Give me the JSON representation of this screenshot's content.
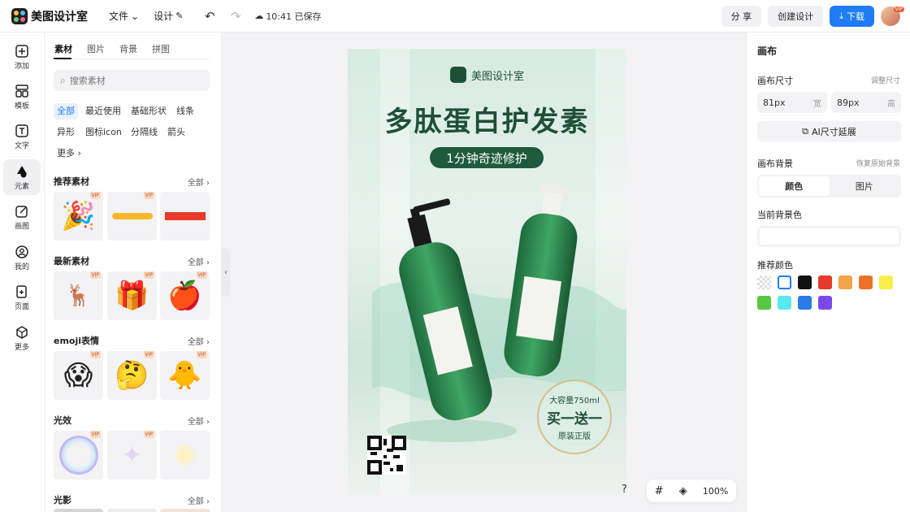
{
  "app": {
    "name": "美图设计室",
    "save_status": "10:41 已保存"
  },
  "topbar": {
    "file_menu": "文件",
    "design_menu": "设计",
    "share": "分 享",
    "create": "创建设计",
    "download": "下载",
    "avatar_badge": "VIP"
  },
  "rail": [
    {
      "label": "添加",
      "icon": "plus-square-icon"
    },
    {
      "label": "模板",
      "icon": "template-icon"
    },
    {
      "label": "文字",
      "icon": "text-icon"
    },
    {
      "label": "元素",
      "icon": "shapes-icon"
    },
    {
      "label": "画图",
      "icon": "pen-icon"
    },
    {
      "label": "我的",
      "icon": "user-icon"
    },
    {
      "label": "页面",
      "icon": "page-icon"
    },
    {
      "label": "更多",
      "icon": "cube-icon"
    }
  ],
  "panel": {
    "tabs": [
      "素材",
      "图片",
      "背景",
      "拼图"
    ],
    "search_placeholder": "搜索素材",
    "chips": [
      "全部",
      "最近使用",
      "基础形状",
      "线条",
      "异形",
      "图标icon",
      "分隔线",
      "箭头",
      "更多"
    ],
    "sections": [
      {
        "title": "推荐素材",
        "all": "全部"
      },
      {
        "title": "最新素材",
        "all": "全部"
      },
      {
        "title": "emoji表情",
        "all": "全部"
      },
      {
        "title": "光效",
        "all": "全部"
      },
      {
        "title": "光影",
        "all": "全部"
      }
    ],
    "vip": "VIP"
  },
  "poster": {
    "brand": "美图设计室",
    "title": "多肽蛋白护发素",
    "pill": "1分钟奇迹修护",
    "badge_top": "大容量750ml",
    "badge_main": "买一送一",
    "badge_bottom": "原装正版"
  },
  "right": {
    "header": "画布",
    "size_label": "画布尺寸",
    "size_link": "调整尺寸",
    "width_value": "81px",
    "width_unit": "宽",
    "height_value": "89px",
    "height_unit": "高",
    "ai_button": "AI尺寸延展",
    "bg_label": "画布背景",
    "bg_link": "恢复原始背景",
    "seg_color": "颜色",
    "seg_image": "图片",
    "current_bg": "当前背景色",
    "recommend": "推荐颜色",
    "swatches": [
      "transparent",
      "#ffffff",
      "#111111",
      "#e8392a",
      "#f3a44a",
      "#ee7128",
      "#f7ef48",
      "#55c93f",
      "#59e8ef",
      "#2b7be9",
      "#7a4ae8"
    ]
  },
  "bottom": {
    "help": "?",
    "zoom": "100%"
  }
}
